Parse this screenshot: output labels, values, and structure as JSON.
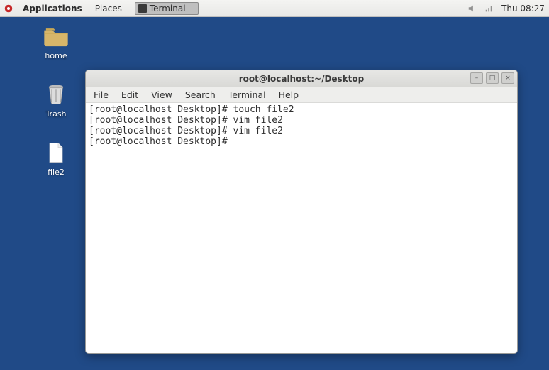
{
  "panel": {
    "apps_label": "Applications",
    "places_label": "Places",
    "taskbar": {
      "label": "Terminal"
    },
    "clock": "Thu 08:27"
  },
  "desktop": {
    "icons": [
      {
        "name": "home",
        "label": "home"
      },
      {
        "name": "trash",
        "label": "Trash"
      },
      {
        "name": "file2",
        "label": "file2"
      }
    ]
  },
  "terminal": {
    "title": "root@localhost:~/Desktop",
    "menus": [
      "File",
      "Edit",
      "View",
      "Search",
      "Terminal",
      "Help"
    ],
    "window_buttons": {
      "min": "–",
      "max": "□",
      "close": "×"
    },
    "lines": [
      {
        "prompt": "[root@localhost Desktop]#",
        "cmd": "touch file2"
      },
      {
        "prompt": "[root@localhost Desktop]#",
        "cmd": "vim file2"
      },
      {
        "prompt": "[root@localhost Desktop]#",
        "cmd": "vim file2"
      },
      {
        "prompt": "[root@localhost Desktop]#",
        "cmd": ""
      }
    ]
  }
}
